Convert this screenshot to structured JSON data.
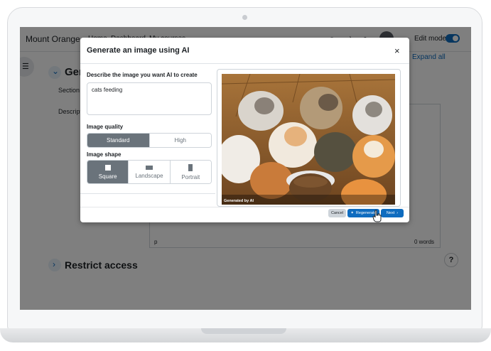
{
  "navbar": {
    "site_name": "Mount Orange",
    "links": [
      "Home",
      "Dashboard",
      "My courses"
    ],
    "edit_mode_label": "Edit mode",
    "edit_mode_on": true
  },
  "page": {
    "expand_all": "Expand all",
    "section_heading": "General",
    "field_section_label": "Section",
    "field_description_label": "Description",
    "editor_path": "p",
    "editor_word_count": "0 words",
    "restrict_access_heading": "Restrict access",
    "help_symbol": "?"
  },
  "modal": {
    "title": "Generate an image using AI",
    "close_symbol": "×",
    "prompt_label": "Describe the image you want AI to create",
    "prompt_value": "cats feeding",
    "quality_label": "Image quality",
    "quality_options": [
      "Standard",
      "High"
    ],
    "quality_selected": "Standard",
    "shape_label": "Image shape",
    "shape_options": [
      "Square",
      "Landscape",
      "Portrait"
    ],
    "shape_selected": "Square",
    "generated_label": "Generated by AI",
    "buttons": {
      "cancel": "Cancel",
      "regenerate": "Regenerate",
      "next": "Next"
    }
  },
  "colors": {
    "primary": "#0f6cbf",
    "selected_option": "#6a737b",
    "overlay": "rgba(0,0,0,0.5)"
  },
  "icons": [
    "menu-icon",
    "search-icon",
    "bell-icon",
    "chat-icon",
    "chevron-down-icon",
    "chevron-right-icon",
    "close-icon",
    "sparkle-icon",
    "chevron-right-icon",
    "hand-pointer-icon"
  ]
}
